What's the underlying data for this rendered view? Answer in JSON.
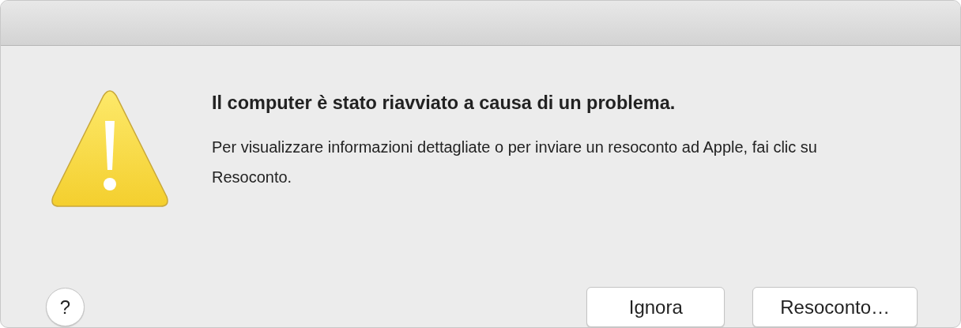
{
  "dialog": {
    "title": "Il computer è stato riavviato a causa di un problema.",
    "message": "Per visualizzare informazioni dettagliate o per inviare un resoconto ad Apple, fai clic su Resoconto.",
    "help": "?",
    "buttons": [
      {
        "label": "Ignora"
      },
      {
        "label": "Resoconto…"
      }
    ]
  }
}
